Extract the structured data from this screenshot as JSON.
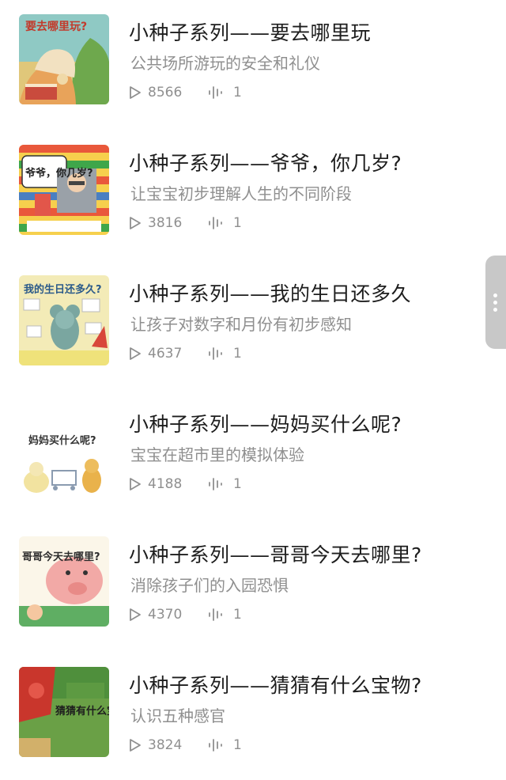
{
  "albums": [
    {
      "title": "小种子系列——要去哪里玩",
      "subtitle": "公共场所游玩的安全和礼仪",
      "plays": "8566",
      "tracks": "1",
      "cover_text": "要去哪里玩?"
    },
    {
      "title": "小种子系列——爷爷，你几岁?",
      "subtitle": "让宝宝初步理解人生的不同阶段",
      "plays": "3816",
      "tracks": "1",
      "cover_text": "爷爷，你几岁?"
    },
    {
      "title": "小种子系列——我的生日还多久",
      "subtitle": "让孩子对数字和月份有初步感知",
      "plays": "4637",
      "tracks": "1",
      "cover_text": "我的生日还多久?"
    },
    {
      "title": "小种子系列——妈妈买什么呢?",
      "subtitle": "宝宝在超市里的模拟体验",
      "plays": "4188",
      "tracks": "1",
      "cover_text": "妈妈买什么呢?"
    },
    {
      "title": "小种子系列——哥哥今天去哪里?",
      "subtitle": "消除孩子们的入园恐惧",
      "plays": "4370",
      "tracks": "1",
      "cover_text": "哥哥今天去哪里?"
    },
    {
      "title": "小种子系列——猜猜有什么宝物?",
      "subtitle": "认识五种感官",
      "plays": "3824",
      "tracks": "1",
      "cover_text": "猜猜有什么宝物"
    }
  ],
  "icons": {
    "plays": "play-icon",
    "tracks": "audio-wave-icon",
    "side_handle": "more-dots-icon"
  },
  "colors": {
    "title": "#1d1d1d",
    "secondary": "#8f8f8f",
    "handle": "#c8c8c8"
  }
}
